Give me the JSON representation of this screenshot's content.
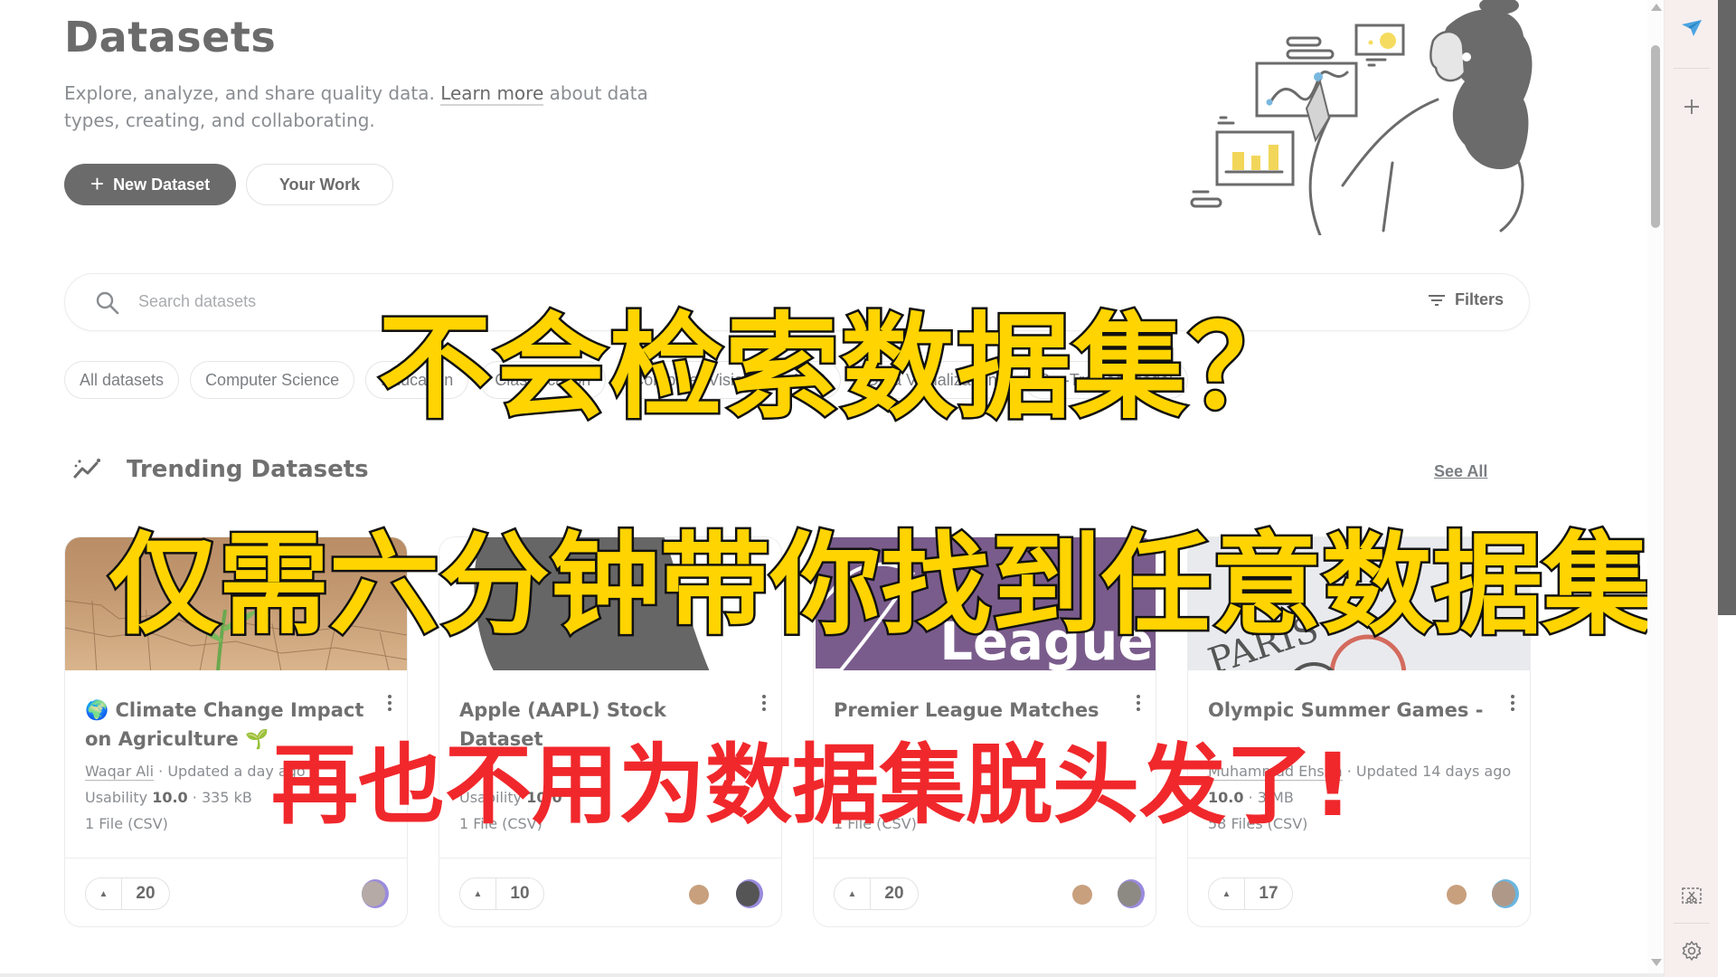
{
  "page": {
    "title": "Datasets",
    "subtitle_before": "Explore, analyze, and share quality data. ",
    "subtitle_link": "Learn more",
    "subtitle_after": " about data types, creating, and collaborating."
  },
  "actions": {
    "new_dataset": "New Dataset",
    "your_work": "Your Work"
  },
  "search": {
    "placeholder": "Search datasets",
    "filters_label": "Filters"
  },
  "chips": [
    "All datasets",
    "Computer Science",
    "Education",
    "Classification",
    "Computer Vision",
    "NLP",
    "Data Visualization",
    "Pre-Trained Model"
  ],
  "trending": {
    "heading": "Trending Datasets",
    "see_all": "See All"
  },
  "cards": [
    {
      "title": "Climate Change Impact on Agriculture",
      "title_prefix_emoji": "🌍",
      "title_suffix_emoji": "🌱",
      "author": "Waqar Ali",
      "updated": "Updated a day ago",
      "usability_label": "Usability",
      "usability": "10.0",
      "size": "335 kB",
      "files": "1 File (CSV)",
      "votes": "20",
      "thumb": "dry-cracked-soil-with-sprout"
    },
    {
      "title": "Apple (AAPL) Stock Dataset",
      "author": "",
      "updated": "",
      "usability_label": "Usability",
      "usability": "10.0",
      "size": "",
      "files": "1 File (CSV)",
      "votes": "10",
      "thumb": "apple-logo"
    },
    {
      "title": "Premier League Matches",
      "author": "",
      "updated": "",
      "usability_label": "",
      "usability": "",
      "size": "",
      "files": "1 File (CSV)",
      "votes": "20",
      "thumb": "premier-league-logo",
      "thumb_text": "League"
    },
    {
      "title": "Olympic Summer Games -",
      "author": "Muhammad Ehsan",
      "updated": "Updated 14 days ago",
      "usability_label": "",
      "usability": "10.0",
      "size": "3 MB",
      "files": "58 Files (CSV)",
      "votes": "17",
      "thumb": "paris-olympics-logo",
      "thumb_text": "PARIS"
    }
  ],
  "overlay": {
    "line1": "不会检索数据集？",
    "line2": "仅需六分钟带你找到任意数据集",
    "line3": "再也不用为数据集脱头发了!"
  },
  "colors": {
    "primary_button": "#6b6b6b",
    "overlay_yellow": "#ffd400",
    "overlay_red": "#f0282c",
    "side_panel": "#f7eeee"
  },
  "side_panel": {
    "icons": [
      "send-icon",
      "plus-icon",
      "screenshot-icon",
      "settings-icon"
    ]
  }
}
